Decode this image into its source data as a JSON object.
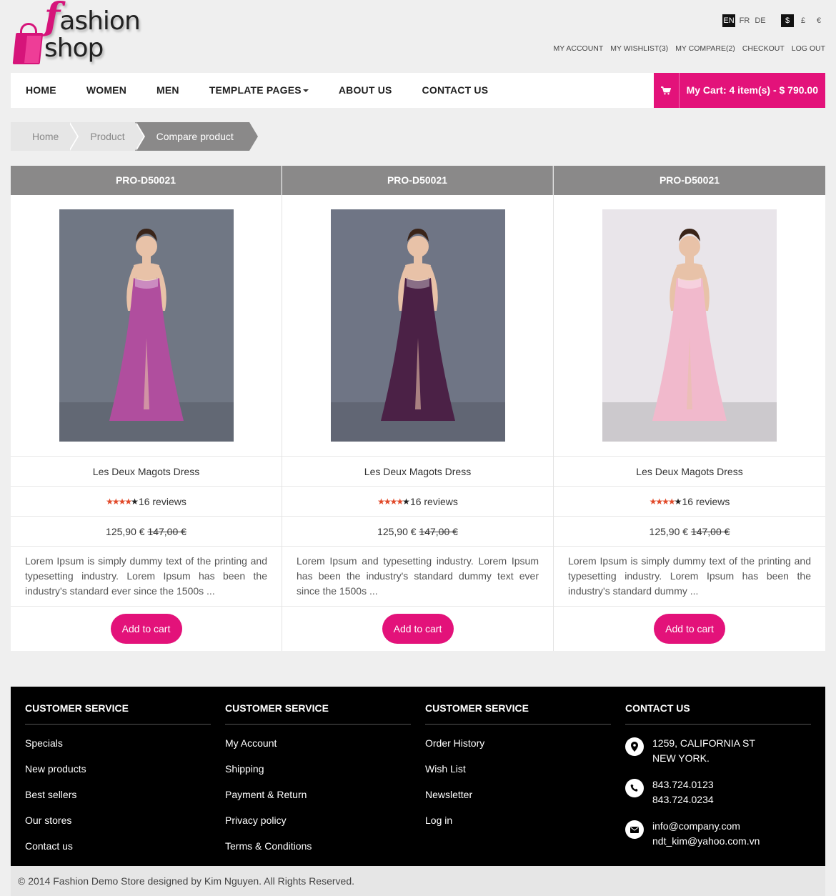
{
  "brand": {
    "logo_f": "f",
    "logo_rest": "ashion shop"
  },
  "languages": [
    "EN",
    "FR",
    "DE"
  ],
  "currencies": [
    "$",
    "£",
    "€"
  ],
  "top_links": [
    "MY ACCOUNT",
    "MY WISHLIST(3)",
    "MY COMPARE(2)",
    "CHECKOUT",
    "LOG OUT"
  ],
  "nav": {
    "items": [
      "HOME",
      "WOMEN",
      "MEN",
      "TEMPLATE PAGES",
      "ABOUT US",
      "CONTACT US"
    ],
    "cart_label": "My Cart: 4 item(s) - $ 790.00"
  },
  "breadcrumb": [
    "Home",
    "Product",
    "Compare product"
  ],
  "products": [
    {
      "code": "PRO-D50021",
      "name": "Les Deux Magots Dress",
      "reviews": "16 reviews",
      "rating": 4,
      "price": "125,90 €",
      "old_price": "147,00 €",
      "description": "Lorem Ipsum is simply dummy text of the printing and typesetting industry. Lorem Ipsum has been the industry's standard ever since the 1500s ...",
      "button": "Add to cart",
      "dress_color": "#b04e9e",
      "bg_color": "#707784"
    },
    {
      "code": "PRO-D50021",
      "name": "Les Deux Magots Dress",
      "reviews": "16 reviews",
      "rating": 4,
      "price": "125,90 €",
      "old_price": "147,00 €",
      "description": "Lorem Ipsum and typesetting industry. Lorem Ipsum has been the industry's standard dummy text ever since the 1500s ...",
      "button": "Add to cart",
      "dress_color": "#4b2146",
      "bg_color": "#6f7585"
    },
    {
      "code": "PRO-D50021",
      "name": "Les Deux Magots Dress",
      "reviews": "16 reviews",
      "rating": 4,
      "price": "125,90 €",
      "old_price": "147,00 €",
      "description": "Lorem Ipsum is simply dummy text of the printing and typesetting industry. Lorem Ipsum has been the industry's standard dummy ...",
      "button": "Add to cart",
      "dress_color": "#f1b9cc",
      "bg_color": "#e9e5ea"
    }
  ],
  "footer": {
    "columns": [
      {
        "title": "CUSTOMER SERVICE",
        "links": [
          "Specials",
          "New products",
          "Best sellers",
          "Our stores",
          "Contact us"
        ]
      },
      {
        "title": "CUSTOMER SERVICE",
        "links": [
          "My Account",
          "Shipping",
          "Payment & Return",
          "Privacy policy",
          "Terms & Conditions"
        ]
      },
      {
        "title": "CUSTOMER SERVICE",
        "links": [
          "Order History",
          "Wish List",
          "Newsletter",
          "Log in"
        ]
      }
    ],
    "contact": {
      "title": "CONTACT US",
      "address": [
        "1259, CALIFORNIA ST",
        "NEW YORK."
      ],
      "phones": [
        "843.724.0123",
        "843.724.0234"
      ],
      "emails": [
        "info@company.com",
        "ndt_kim@yahoo.com.vn"
      ]
    }
  },
  "copyright": "© 2014 Fashion Demo Store designed by Kim Nguyen. All Rights Reserved.",
  "colors": {
    "accent": "#e3127a",
    "header_gray": "#8a8989",
    "footer_bg": "#000000"
  }
}
